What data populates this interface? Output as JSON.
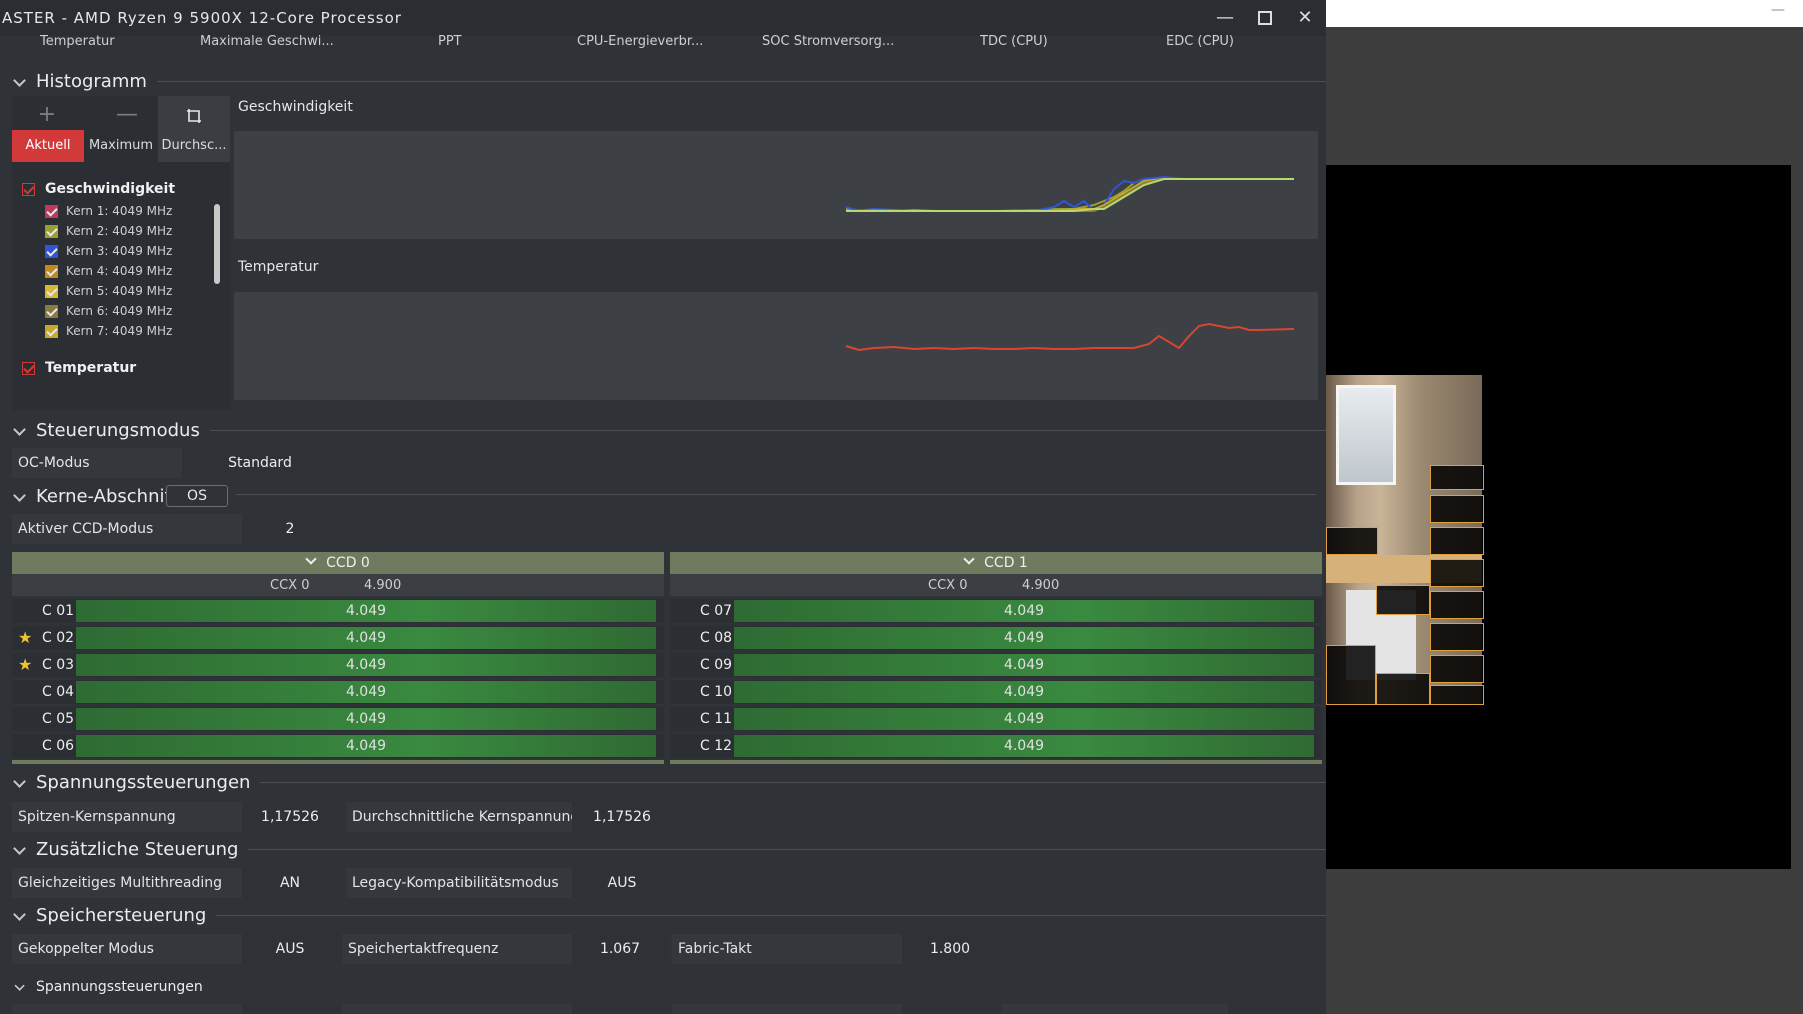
{
  "window": {
    "title": "ASTER  -  AMD Ryzen 9 5900X 12-Core Processor",
    "minimize": "—",
    "close": "✕"
  },
  "columns": [
    "Temperatur",
    "Maximale Geschwi...",
    "PPT",
    "CPU-Energieverbr...",
    "SOC Stromversorg...",
    "TDC (CPU)",
    "EDC (CPU)"
  ],
  "histogram": {
    "title": "Histogramm",
    "tools": [
      "+",
      "—"
    ],
    "buttons": {
      "current": "Aktuell",
      "max": "Maximum",
      "avg": "Durchsc..."
    },
    "groups": {
      "speed": "Geschwindigkeit",
      "temp": "Temperatur"
    },
    "cores": [
      {
        "label": "Kern 1: 4049 MHz",
        "color": "#c0395a"
      },
      {
        "label": "Kern 2: 4049 MHz",
        "color": "#9aa030"
      },
      {
        "label": "Kern 3: 4049 MHz",
        "color": "#2f55d8"
      },
      {
        "label": "Kern 4: 4049 MHz",
        "color": "#c08a20"
      },
      {
        "label": "Kern 5: 4049 MHz",
        "color": "#d8b830"
      },
      {
        "label": "Kern 6: 4049 MHz",
        "color": "#8a7a40"
      },
      {
        "label": "Kern 7: 4049 MHz",
        "color": "#c8a828"
      }
    ],
    "chart_titles": {
      "speed": "Geschwindigkeit",
      "temp": "Temperatur"
    }
  },
  "control_mode": {
    "title": "Steuerungsmodus",
    "oc_label": "OC-Modus",
    "oc_value": "Standard"
  },
  "cores_section": {
    "title": "Kerne-Abschnitt",
    "os_button": "OS",
    "ccd_mode_label": "Aktiver CCD-Modus",
    "ccd_mode_value": "2"
  },
  "ccds": [
    {
      "name": "CCD 0",
      "ccx": "CCX 0",
      "ccx_value": "4.900",
      "cores": [
        {
          "name": "C 01",
          "value": "4.049",
          "star": false
        },
        {
          "name": "C 02",
          "value": "4.049",
          "star": true
        },
        {
          "name": "C 03",
          "value": "4.049",
          "star": true
        },
        {
          "name": "C 04",
          "value": "4.049",
          "star": false
        },
        {
          "name": "C 05",
          "value": "4.049",
          "star": false
        },
        {
          "name": "C 06",
          "value": "4.049",
          "star": false
        }
      ]
    },
    {
      "name": "CCD 1",
      "ccx": "CCX 0",
      "ccx_value": "4.900",
      "cores": [
        {
          "name": "C 07",
          "value": "4.049",
          "star": false
        },
        {
          "name": "C 08",
          "value": "4.049",
          "star": false
        },
        {
          "name": "C 09",
          "value": "4.049",
          "star": false
        },
        {
          "name": "C 10",
          "value": "4.049",
          "star": false
        },
        {
          "name": "C 11",
          "value": "4.049",
          "star": false
        },
        {
          "name": "C 12",
          "value": "4.049",
          "star": false
        }
      ]
    }
  ],
  "voltage": {
    "title": "Spannungssteuerungen",
    "peak_label": "Spitzen-Kernspannung",
    "peak_value": "1,17526",
    "avg_label": "Durchschnittliche Kernspannung",
    "avg_value": "1,17526"
  },
  "extra": {
    "title": "Zusätzliche Steuerung",
    "smt_label": "Gleichzeitiges Multithreading",
    "smt_value": "AN",
    "legacy_label": "Legacy-Kompatibilitätsmodus",
    "legacy_value": "AUS"
  },
  "memory": {
    "title": "Speichersteuerung",
    "coupled_label": "Gekoppelter Modus",
    "coupled_value": "AUS",
    "memclk_label": "Speichertaktfrequenz",
    "memclk_value": "1.067",
    "fabric_label": "Fabric-Takt",
    "fabric_value": "1.800"
  },
  "voltage2": {
    "title": "Spannungssteuerungen"
  }
}
